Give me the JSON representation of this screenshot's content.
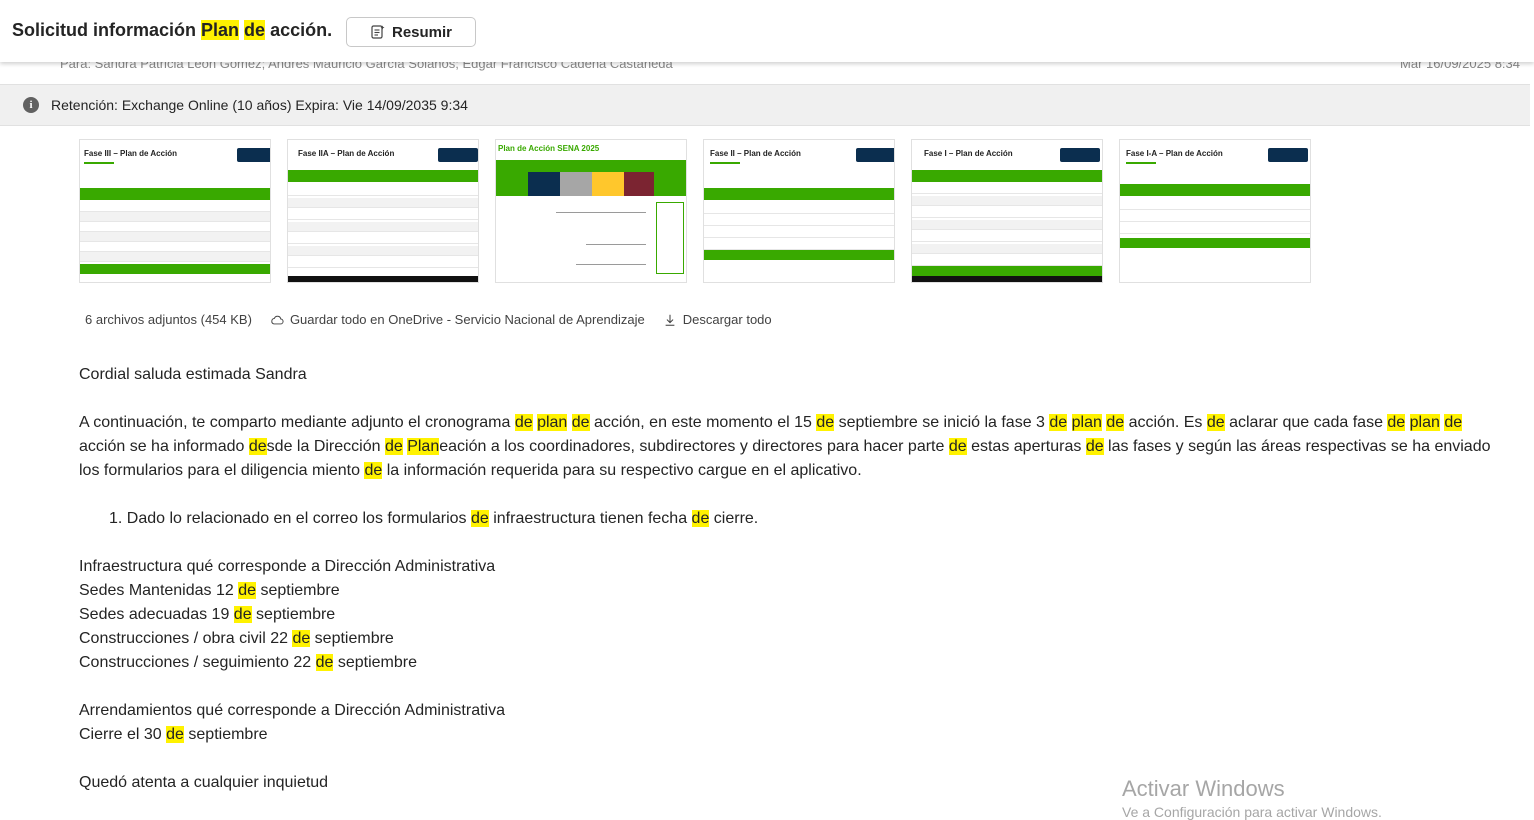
{
  "header": {
    "subject_parts": [
      "Solicitud información ",
      "Plan",
      " ",
      "de",
      " acción."
    ],
    "summarize_label": "Resumir",
    "to_line_partial": "Para:  Sandra Patricia León Gómez;  Andrés Mauricio García Solanos;  Edgar Francisco Cadena Castañeda",
    "date_partial": "Mar 16/09/2025 8:34"
  },
  "retention": {
    "text": "Retención: Exchange Online (10 años) Expira: Vie 14/09/2035 9:34"
  },
  "attachments": {
    "thumbnails": [
      {
        "title": "Fase III – Plan de Acción"
      },
      {
        "title": "Fase IIA – Plan de Acción"
      },
      {
        "title": "Plan de Acción SENA 2025"
      },
      {
        "title": "Fase II – Plan de Acción"
      },
      {
        "title": "Fase I – Plan de Acción"
      },
      {
        "title": "Fase I-A – Plan de Acción"
      }
    ],
    "summary": "6 archivos adjuntos (454 KB)",
    "save_all_label": "Guardar todo en OneDrive - Servicio Nacional de Aprendizaje",
    "download_all_label": "Descargar todo"
  },
  "message": {
    "greeting": "Cordial saluda estimada Sandra",
    "list_item_1_parts": [
      "1. Dado lo relacionado en el correo los formularios ",
      "de",
      " infraestructura tienen fecha ",
      "de",
      " cierre."
    ],
    "infra_title": "Infraestructura qué corresponde a Dirección Administrativa",
    "line_sedes_mant": [
      "Sedes Mantenidas 12 ",
      "de",
      " septiembre"
    ],
    "line_sedes_adec": [
      "Sedes adecuadas 19 ",
      "de",
      " septiembre"
    ],
    "line_const_obra": [
      "Construcciones / obra civil 22 ",
      "de",
      " septiembre"
    ],
    "line_const_seg": [
      "Construcciones / seguimiento 22 ",
      "de",
      " septiembre"
    ],
    "arrend_title": "Arrendamientos qué corresponde a Dirección Administrativa",
    "line_cierre": [
      "Cierre el 30 ",
      "de",
      " septiembre"
    ],
    "closing": "Quedó atenta a cualquier inquietud"
  },
  "watermark": {
    "title": "Activar Windows",
    "subtitle": "Ve a Configuración para activar Windows."
  },
  "colors": {
    "highlight": "#fff200",
    "brand_green": "#39a900",
    "retention_bg": "#f0f0f0"
  }
}
